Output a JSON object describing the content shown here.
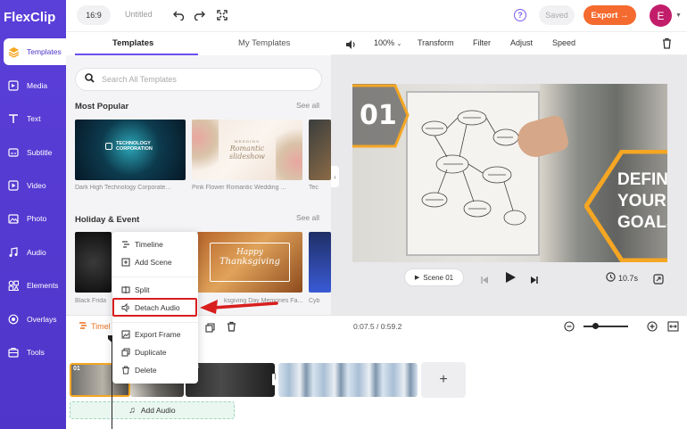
{
  "app": {
    "logo": "FlexClip"
  },
  "sidebar": {
    "items": [
      {
        "label": "Templates",
        "icon": "templates-icon"
      },
      {
        "label": "Media",
        "icon": "media-icon"
      },
      {
        "label": "Text",
        "icon": "text-icon"
      },
      {
        "label": "Subtitle",
        "icon": "subtitle-icon"
      },
      {
        "label": "Video",
        "icon": "video-icon"
      },
      {
        "label": "Photo",
        "icon": "photo-icon"
      },
      {
        "label": "Audio",
        "icon": "audio-icon"
      },
      {
        "label": "Elements",
        "icon": "elements-icon"
      },
      {
        "label": "Overlays",
        "icon": "overlays-icon"
      },
      {
        "label": "Tools",
        "icon": "tools-icon"
      }
    ]
  },
  "topbar": {
    "ratio": "16:9",
    "title": "Untitled",
    "help": "?",
    "saved": "Saved",
    "export": "Export →",
    "avatar": "E"
  },
  "panel": {
    "tabs": [
      "Templates",
      "My Templates"
    ],
    "search_placeholder": "Search All Templates",
    "sections": [
      {
        "title": "Most Popular",
        "see_all": "See all",
        "items": [
          {
            "caption": "Dark High Technology Corporate...",
            "overlay_line1": "TECHNOLOGY",
            "overlay_line2": "CORPORATION"
          },
          {
            "caption": "Pink Flower Romantic Wedding ...",
            "overlay_line1": "WEDDING",
            "overlay_line2": "Romantic slideshow"
          },
          {
            "caption": "Tec"
          }
        ]
      },
      {
        "title": "Holiday & Event",
        "see_all": "See all",
        "items": [
          {
            "caption": "Black Frida"
          },
          {
            "caption": "ksgiving Day Memories Fa...",
            "overlay_line1": "Happy",
            "overlay_line2": "Thanksgiving"
          },
          {
            "caption": "Cyb"
          }
        ]
      }
    ]
  },
  "preview_bar": {
    "zoom": "100%",
    "items": [
      "Transform",
      "Filter",
      "Adjust",
      "Speed"
    ]
  },
  "video": {
    "number": "01",
    "slogan": [
      "DEFINE",
      "YOUR",
      "GOALS"
    ]
  },
  "controls": {
    "scene": "Scene 01",
    "duration": "10.7s"
  },
  "timeline": {
    "label": "Timel",
    "time": "0:07.5 / 0:59.2",
    "clip1_num": "01",
    "clip3_num": "3",
    "add_audio": "Add Audio"
  },
  "context_menu": {
    "items": [
      "Timeline",
      "Add Scene",
      "Split",
      "Detach Audio",
      "Export Frame",
      "Duplicate",
      "Delete"
    ]
  },
  "colors": {
    "sidebar": "#5b3fd9",
    "accent": "#6b4ff0",
    "export": "#f56a2e",
    "highlight": "#d81e1e"
  }
}
